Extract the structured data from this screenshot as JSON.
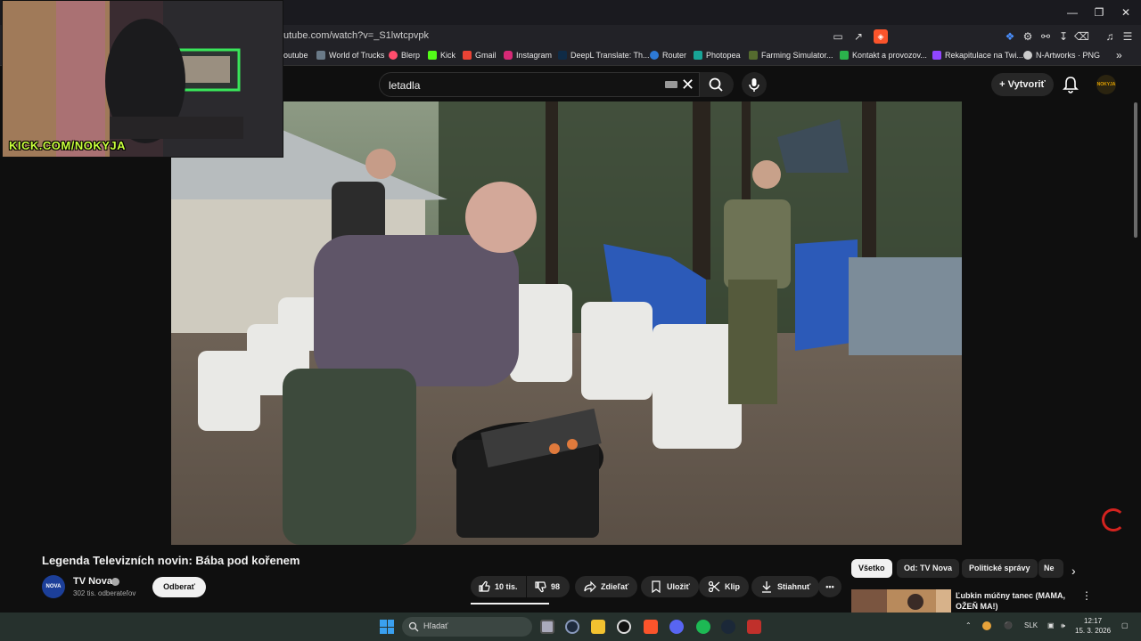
{
  "browser": {
    "url": "utube.com/watch?v=_S1lwtcpvpk",
    "bookmarks": [
      {
        "label": "outube",
        "color": "#ff0000"
      },
      {
        "label": "World of Trucks",
        "color": "#6a7a88"
      },
      {
        "label": "Blerp",
        "color": "#ff4d6d"
      },
      {
        "label": "Kick",
        "color": "#53fc18"
      },
      {
        "label": "Gmail",
        "color": "#ea4335"
      },
      {
        "label": "Instagram",
        "color": "#d62976"
      },
      {
        "label": "DeepL Translate: Th...",
        "color": "#0f2b46"
      },
      {
        "label": "Router",
        "color": "#2d7ad6"
      },
      {
        "label": "Photopea",
        "color": "#18a497"
      },
      {
        "label": "Farming Simulator...",
        "color": "#556b2f"
      },
      {
        "label": "Kontakt a provozov...",
        "color": "#2bb24c"
      },
      {
        "label": "Rekapitulace na Twi...",
        "color": "#9146ff"
      },
      {
        "label": "N-Artworks · PNG",
        "color": "#cccccc"
      }
    ],
    "bookmarks_more": "»"
  },
  "youtube": {
    "search_query": "letadla",
    "create_label": "Vytvoriť",
    "avatar_text": "NOKYJA"
  },
  "webcam": {
    "overlay_text": "KICK.COM/NOKYJA"
  },
  "video": {
    "title": "Legenda Televizních novin: Bába pod kořenem",
    "channel": {
      "name": "TV Nova",
      "subscribers": "302 tis. odberateľov",
      "avatar_text": "NOVA"
    },
    "subscribe_label": "Odberať",
    "actions": {
      "likes": "10 tis.",
      "dislikes": "98",
      "share": "Zdieľať",
      "save": "Uložiť",
      "clip": "Klip",
      "download": "Stiahnuť",
      "more": "•••"
    }
  },
  "sidebar": {
    "chips": [
      "Všetko",
      "Od: TV Nova",
      "Politické správy",
      "Ne"
    ],
    "next": "›",
    "recommended": {
      "title": "Ľubkin múčny tanec (MAMA, OŽEŇ MA!)"
    }
  },
  "taskbar": {
    "search_placeholder": "Hľadať",
    "language": "SLK",
    "time": "12:17",
    "date": "15. 3. 2026"
  },
  "colors": {
    "youtube_bg": "#0f0f0f",
    "taskbar_bg": "#26312d",
    "accent_red": "#d4231f",
    "webcam_tag": "#c8ff3c"
  }
}
